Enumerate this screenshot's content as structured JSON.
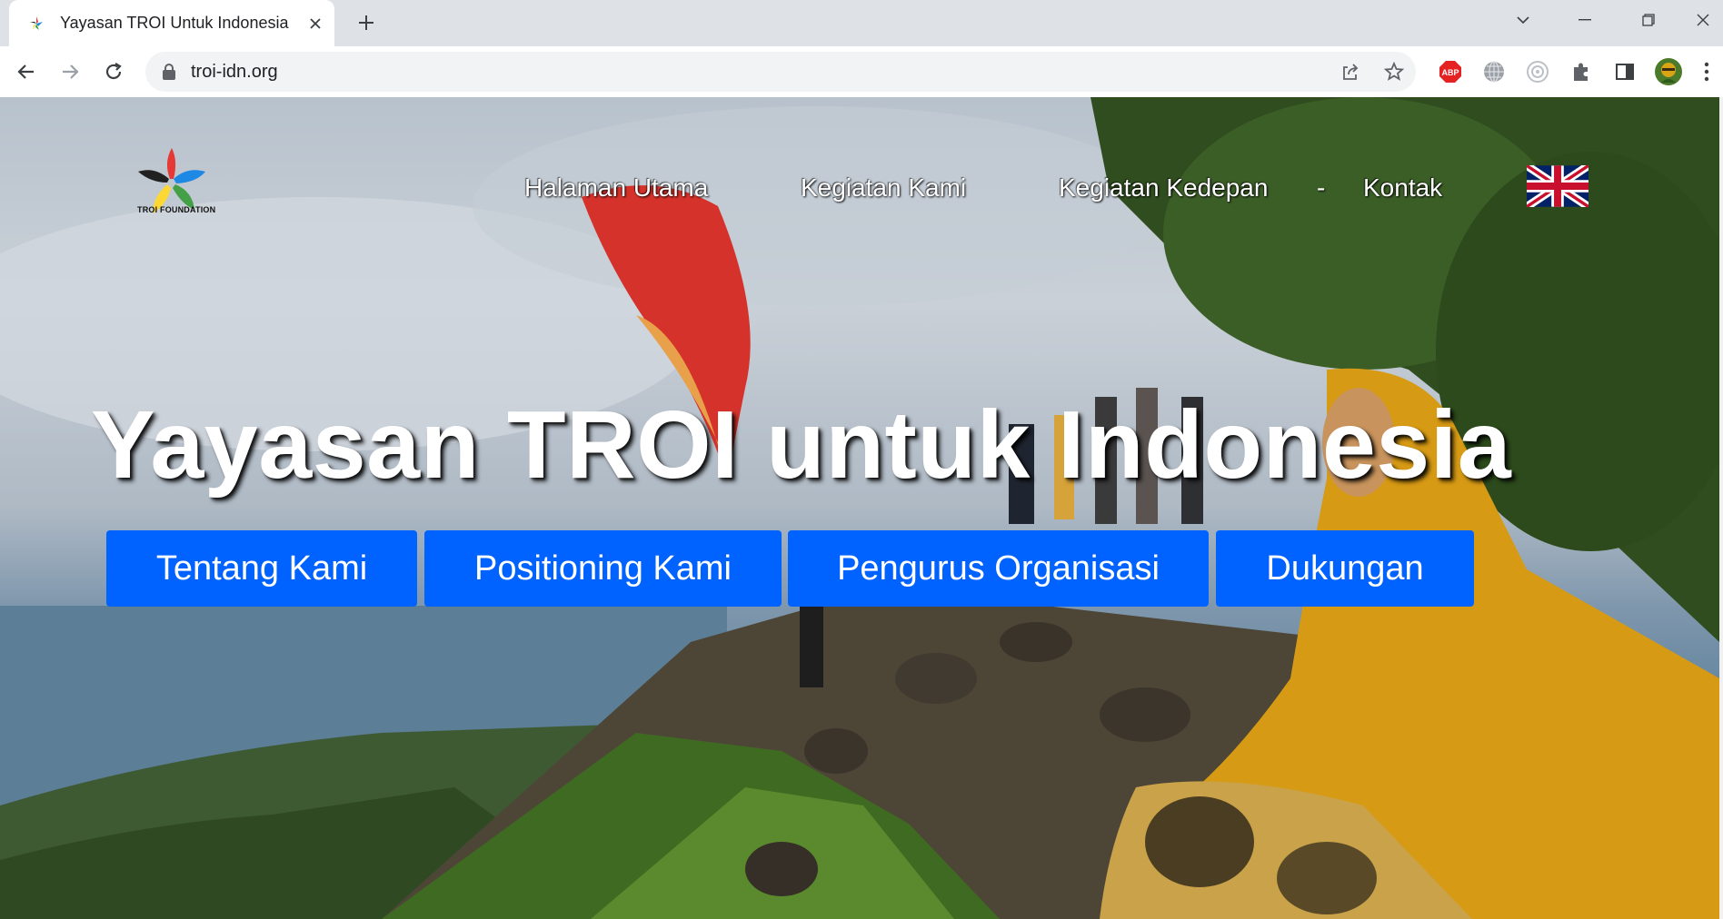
{
  "browser": {
    "tab_title": "Yayasan TROI Untuk Indonesia",
    "url": "troi-idn.org",
    "extensions": [
      "adblock-plus-icon",
      "globe-icon",
      "target-icon",
      "puzzle-icon",
      "sidepanel-icon",
      "profile-avatar"
    ]
  },
  "site": {
    "logo_caption": "TROI FOUNDATION",
    "nav": {
      "home": "Halaman Utama",
      "activities": "Kegiatan Kami",
      "upcoming": "Kegiatan Kedepan",
      "separator": "-",
      "contact": "Kontak"
    },
    "language_flag": "uk-flag-icon",
    "headline": "Yayasan TROI untuk Indonesia",
    "buttons": {
      "about": "Tentang Kami",
      "positioning": "Positioning Kami",
      "board": "Pengurus Organisasi",
      "support": "Dukungan"
    },
    "accent_color": "#0062ff"
  }
}
